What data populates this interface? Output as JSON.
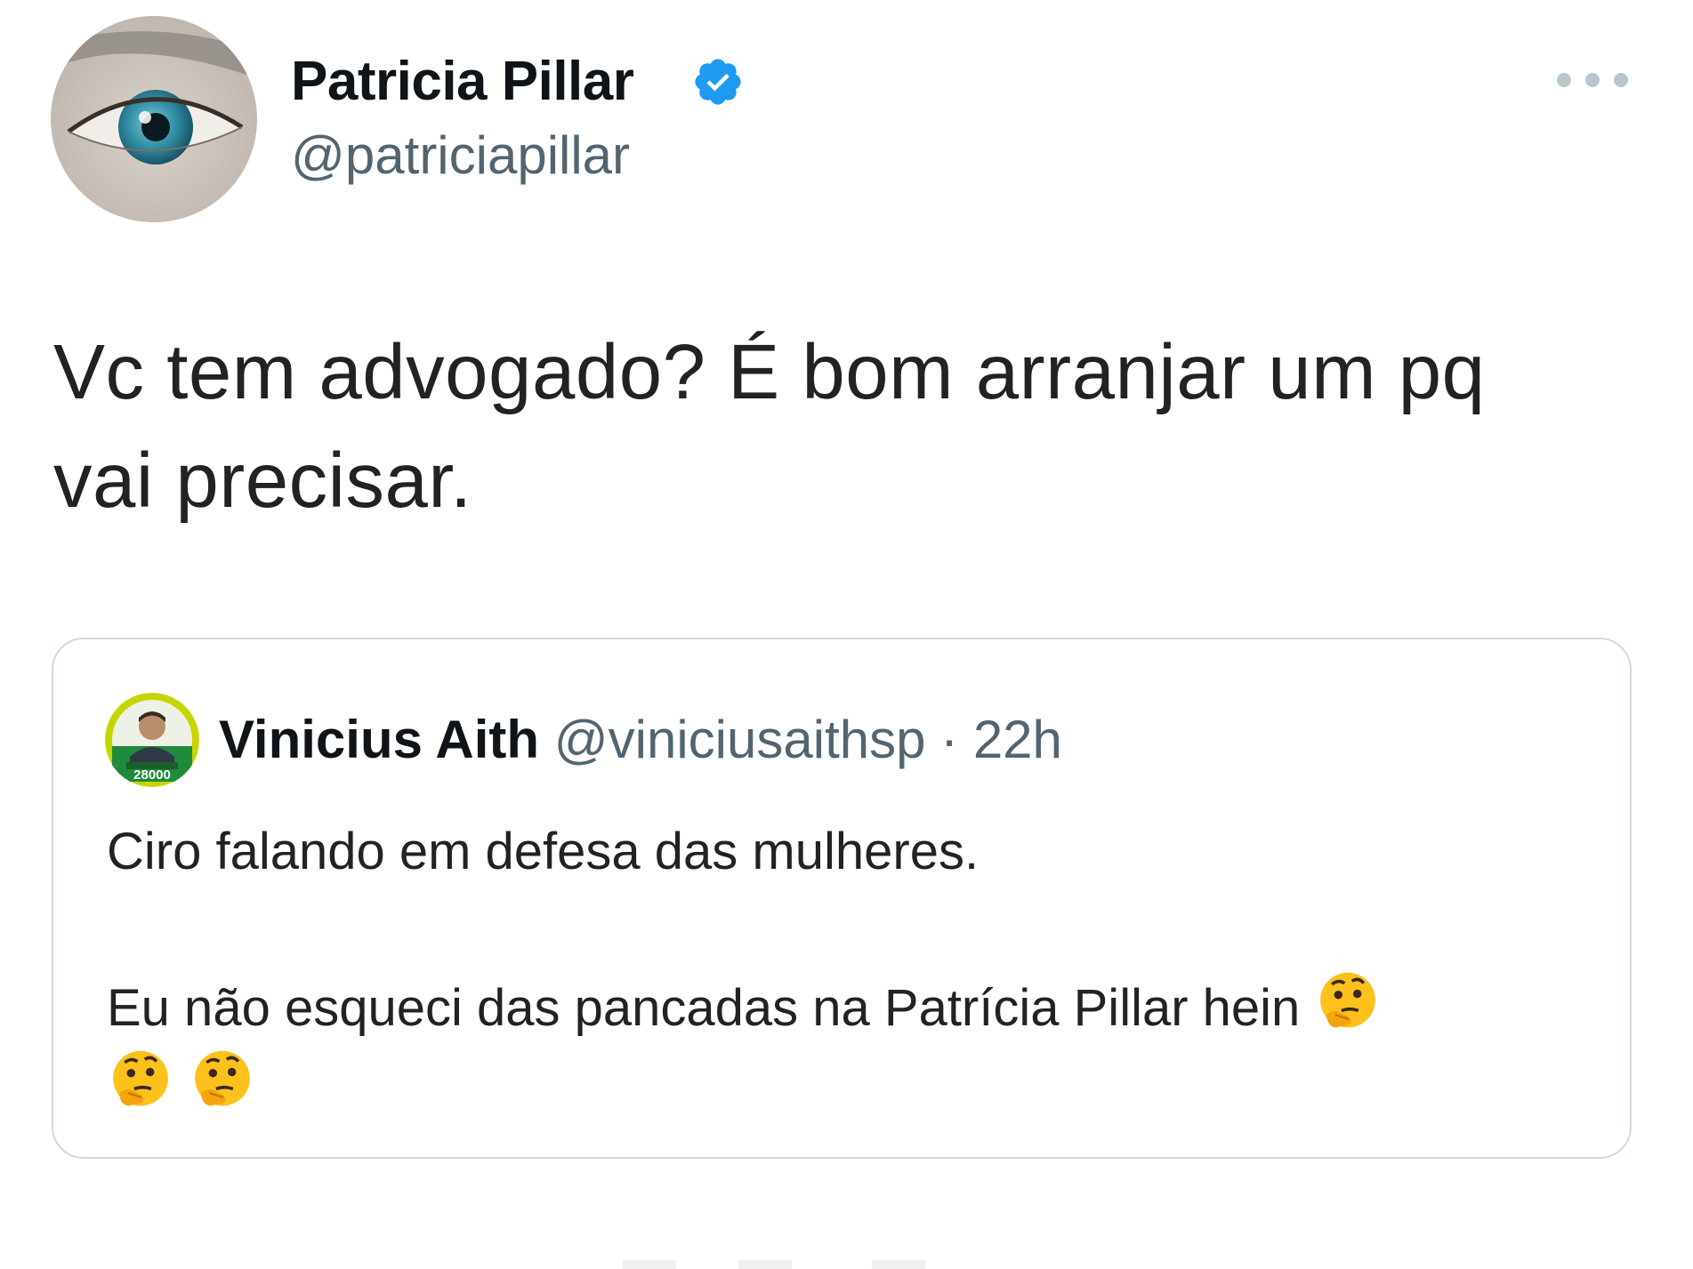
{
  "tweet": {
    "author_name": "Patricia Pillar",
    "author_handle": "@patriciapillar",
    "verified": true,
    "text_line1": "Vc tem advogado? É bom arranjar um pq",
    "text_line2": "vai precisar.",
    "more_icon": "more-horizontal-icon",
    "accent_color": "#1d9bf0"
  },
  "quote": {
    "author_name": "Vinicius Aith",
    "author_handle": "@viniciusaithsp",
    "separator": "·",
    "timestamp": "22h",
    "avatar_badge": "28000",
    "line1": "Ciro falando em defesa das mulheres.",
    "line2": "Eu não esqueci das pancadas na Patrícia Pillar hein",
    "emoji": "thinking-face-icon"
  }
}
